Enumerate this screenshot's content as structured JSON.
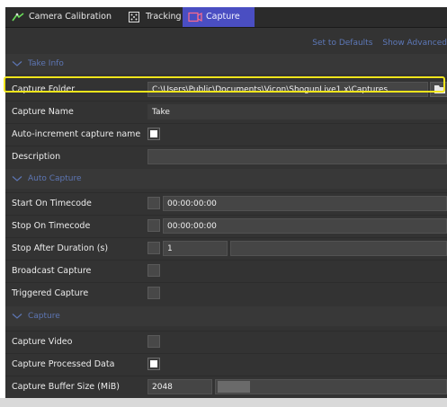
{
  "tabs": [
    {
      "label": "Camera Calibration",
      "icon": "camera-calibration-icon"
    },
    {
      "label": "Tracking",
      "icon": "tracking-icon"
    },
    {
      "label": "Capture",
      "icon": "capture-icon",
      "active": true
    }
  ],
  "links": {
    "set_defaults": "Set to Defaults",
    "show_advanced": "Show Advanced"
  },
  "sections": {
    "take_info": "Take Info",
    "auto_capture": "Auto Capture",
    "capture": "Capture"
  },
  "fields": {
    "capture_folder": {
      "label": "Capture Folder",
      "value": "C:\\Users\\Public\\Documents\\Vicon\\ShogunLive1.x\\Captures"
    },
    "capture_name": {
      "label": "Capture Name",
      "value": "Take"
    },
    "auto_increment": {
      "label": "Auto-increment capture name",
      "checked": true
    },
    "description": {
      "label": "Description",
      "value": ""
    },
    "start_on_timecode": {
      "label": "Start On Timecode",
      "checked": false,
      "value": "00:00:00:00"
    },
    "stop_on_timecode": {
      "label": "Stop On Timecode",
      "checked": false,
      "value": "00:00:00:00"
    },
    "stop_after_duration": {
      "label": "Stop After Duration (s)",
      "checked": false,
      "value": "1"
    },
    "broadcast_capture": {
      "label": "Broadcast Capture",
      "checked": false
    },
    "triggered_capture": {
      "label": "Triggered Capture",
      "checked": false
    },
    "capture_video": {
      "label": "Capture Video",
      "checked": false
    },
    "capture_processed_data": {
      "label": "Capture Processed Data",
      "checked": true
    },
    "capture_buffer_size": {
      "label": "Capture Buffer Size (MiB)",
      "value": "2048"
    }
  },
  "colors": {
    "active_tab": "#4a4ec2",
    "link": "#5d78b8",
    "highlight": "#f1e51c",
    "panel": "#333333"
  }
}
